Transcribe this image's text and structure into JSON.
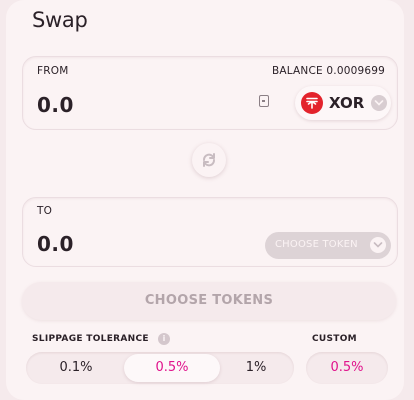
{
  "swap": {
    "title": "Swap",
    "from": {
      "label": "FROM",
      "balance_label": "BALANCE",
      "balance_value": "0.0009699",
      "amount": "0.0",
      "token_symbol": "XOR",
      "token_icon": "xor-logo-icon",
      "token_color": "#e3232c"
    },
    "switch_icon": "swap-arrows-icon",
    "to": {
      "label": "TO",
      "amount": "0.0",
      "choose_token_label": "CHOOSE TOKEN"
    },
    "submit_label": "CHOOSE TOKENS",
    "slippage": {
      "label": "SLIPPAGE TOLERANCE",
      "info_icon": "info-icon",
      "options": [
        "0.1%",
        "0.5%",
        "1%"
      ],
      "selected": "0.5%",
      "custom_label": "CUSTOM",
      "custom_value": "0.5%"
    },
    "accent_color": "#e0138c"
  }
}
